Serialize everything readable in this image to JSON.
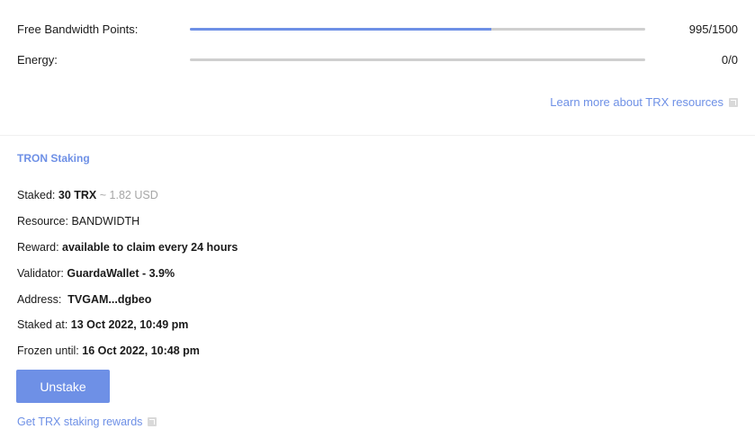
{
  "resources": {
    "bandwidth": {
      "label": "Free Bandwidth Points:",
      "value": "995/1500",
      "fill_fraction": 0.663
    },
    "energy": {
      "label": "Energy:",
      "value": "0/0",
      "fill_fraction": 0
    },
    "learn_more": "Learn more about TRX resources"
  },
  "staking": {
    "title": "TRON Staking",
    "staked_label": "Staked:",
    "staked_amount": "30 TRX",
    "staked_usd": "~ 1.82 USD",
    "resource_text": "Resource: BANDWIDTH",
    "reward_label": "Reward:",
    "reward_value": "available to claim every 24 hours",
    "validator_label": "Validator:",
    "validator_value": "GuardaWallet - 3.9%",
    "address_label": "Address:",
    "address_value": "TVGAM...dgbeo",
    "staked_at_label": "Staked at:",
    "staked_at_value": "13 Oct 2022, 10:49 pm",
    "frozen_label": "Frozen until:",
    "frozen_value": "16 Oct 2022, 10:48 pm",
    "unstake_button": "Unstake",
    "get_rewards_link": "Get TRX staking rewards"
  },
  "colors": {
    "accent": "#6e90e6",
    "track": "#cfcfcf",
    "muted": "#a6a6a6"
  },
  "icons": {
    "external_link": "external-link-icon"
  }
}
